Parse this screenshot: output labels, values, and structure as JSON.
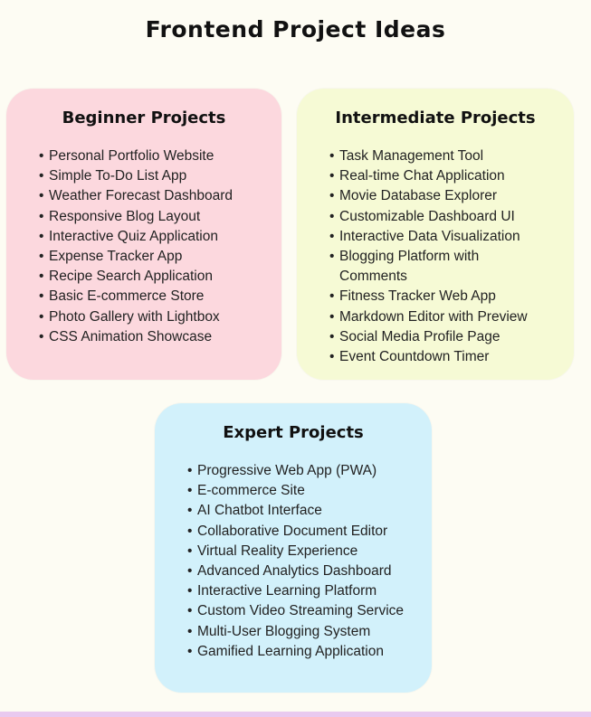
{
  "title": "Frontend Project Ideas",
  "colors": {
    "background": "#fdfcf3",
    "beginner_card": "#fcd8de",
    "intermediate_card": "#f6fad5",
    "expert_card": "#d2f1fb"
  },
  "beginner": {
    "title": "Beginner Projects",
    "items": [
      "Personal Portfolio Website",
      "Simple To-Do List App",
      "Weather Forecast Dashboard",
      "Responsive Blog Layout",
      "Interactive Quiz Application",
      "Expense Tracker App",
      "Recipe Search Application",
      "Basic E-commerce Store",
      "Photo Gallery with Lightbox",
      "CSS Animation Showcase"
    ]
  },
  "intermediate": {
    "title": "Intermediate Projects",
    "items": [
      "Task Management Tool",
      "Real-time Chat Application",
      "Movie Database Explorer",
      "Customizable Dashboard UI",
      "Interactive Data Visualization",
      "Blogging Platform with Comments",
      "Fitness Tracker Web App",
      "Markdown Editor with Preview",
      "Social Media Profile Page",
      "Event Countdown Timer"
    ]
  },
  "expert": {
    "title": "Expert Projects",
    "items": [
      "Progressive Web App (PWA)",
      "E-commerce Site",
      "AI Chatbot Interface",
      "Collaborative Document Editor",
      "Virtual Reality Experience",
      "Advanced Analytics Dashboard",
      "Interactive Learning Platform",
      "Custom Video Streaming Service",
      "Multi-User Blogging System",
      "Gamified Learning Application"
    ]
  }
}
